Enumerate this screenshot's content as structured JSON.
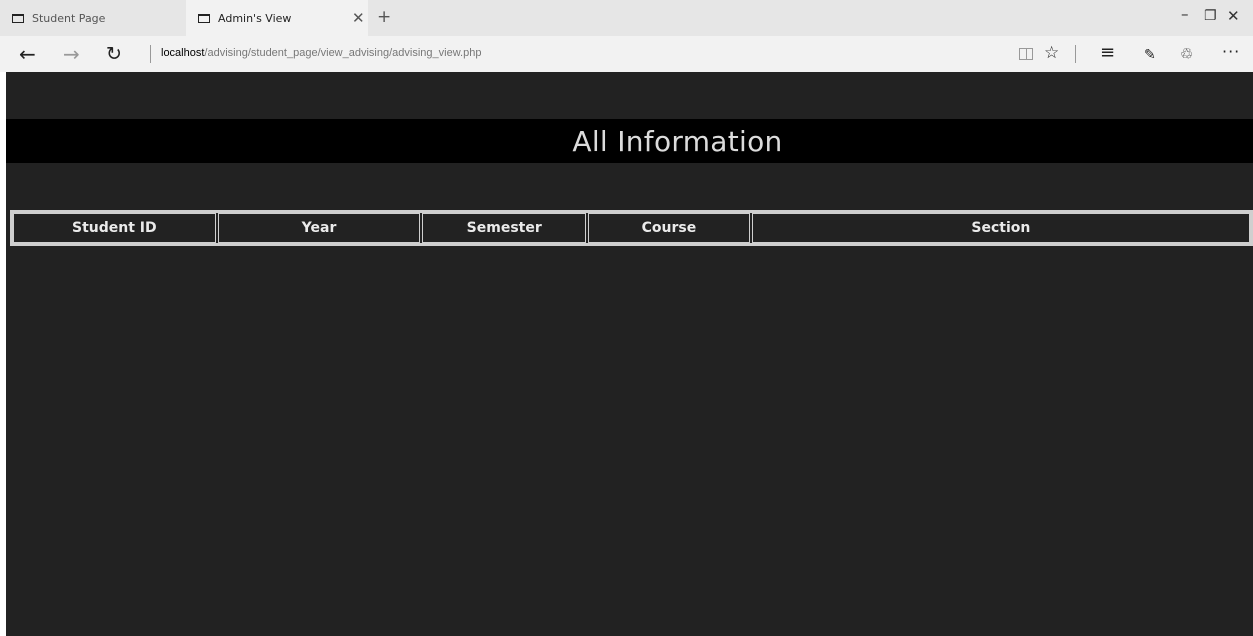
{
  "browser": {
    "tabs": [
      {
        "label": "Student Page"
      },
      {
        "label": "Admin's View"
      }
    ],
    "tab_close_glyph": "✕",
    "new_tab_glyph": "+",
    "window_controls": {
      "minimize": "–",
      "restore": "❐",
      "close": "✕"
    },
    "url": {
      "host": "localhost",
      "path": "/advising/student_page/view_advising/advising_view.php"
    },
    "nav": {
      "back": "←",
      "forward": "→",
      "refresh": "↻"
    },
    "toolbar_glyphs": {
      "favorite": "☆",
      "hub": "≡",
      "notes": "✎",
      "share": "♲",
      "more": "···"
    }
  },
  "page": {
    "title": "All Information",
    "table": {
      "columns": [
        "Student ID",
        "Year",
        "Semester",
        "Course",
        "Section"
      ]
    }
  },
  "colors": {
    "page_bg": "#222222",
    "title_bar_bg": "#000000",
    "text": "#eaeaea",
    "table_border": "#cfcfcf"
  }
}
